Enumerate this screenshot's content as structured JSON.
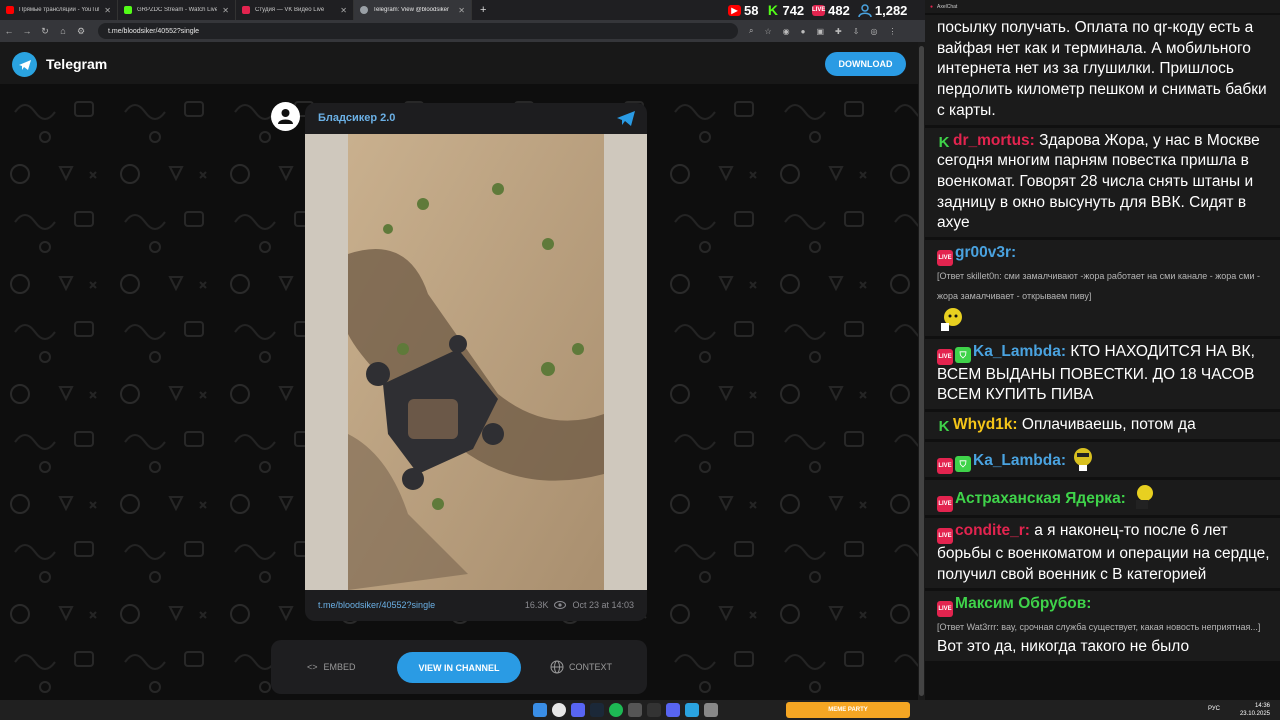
{
  "browser": {
    "tabs": [
      {
        "title": "Прямые трансляции - YouTube",
        "color": "#ff0000"
      },
      {
        "title": "GRPZDC Stream - Watch Live o",
        "color": "#53fc18"
      },
      {
        "title": "Студия — VK Видео Live",
        "color": "#e3244f"
      },
      {
        "title": "Telegram: View @bloodsiker",
        "color": "#9aa0a6"
      }
    ],
    "new_tab": "+",
    "url": "t.me/bloodsiker/40552?single"
  },
  "stream_stats": {
    "youtube": "58",
    "kick": "742",
    "vk": "482",
    "viewers": "1,282"
  },
  "telegram": {
    "brand": "Telegram",
    "download": "DOWNLOAD",
    "channel_name": "Бладсикер 2.0",
    "post_link": "t.me/bloodsiker/40552?single",
    "views": "16.3K",
    "date": "Oct 23 at 14:03",
    "embed": "EMBED",
    "view_in_channel": "VIEW IN CHANNEL",
    "context": "CONTEXT"
  },
  "chat": {
    "app_title": "AxelChat",
    "messages": [
      {
        "text": "посылку получать. Оплата по qr-коду есть а вайфая нет как и терминала. А мобильного интернета нет из за глушилки. Пришлось пердолить километр пешком и снимать бабки с карты."
      },
      {
        "nick": "dr_mortus:",
        "text": "Здарова Жора, у нас в Москве сегодня многим парням повестка пришла в военкомат. Говорят 28 числа снять штаны и задницу в окно высунуть для ВВК. Сидят в ахуе"
      },
      {
        "nick": "gr00v3r:",
        "reply": "[Ответ skillet0n: сми замалчивают -жора работает на сми канале - жора сми - жора замалчивает - открываем пиву]"
      },
      {
        "nick": "Ka_Lambda:",
        "text": "КТО НАХОДИТСЯ НА ВК, ВСЕМ ВЫДАНЫ ПОВЕСТКИ. ДО 18 ЧАСОВ ВСЕМ КУПИТЬ ПИВА"
      },
      {
        "nick": "Whyd1k:",
        "text": "Оплачиваешь, потом да"
      },
      {
        "nick": "Ka_Lambda:"
      },
      {
        "nick": "Астраханская Ядерка:"
      },
      {
        "nick": "condite_r:",
        "text": "а я наконец-то после 6 лет борьбы с военкоматом и операции на сердце, получил свой военник с В категорией"
      },
      {
        "nick": "Максим Обрубов:",
        "reply": "[Ответ Wat3rrr: вау, срочная служба существует, какая новость неприятная...]",
        "text": "Вот это да, никогда такого не было"
      }
    ]
  },
  "taskbar": {
    "lang": "РУС",
    "time": "14:36",
    "date": "23.10.2025",
    "meme_party": "MEME PARTY"
  },
  "colors": {
    "telegram_blue": "#2a9be4",
    "link_blue": "#6bb0e5",
    "nick_red": "#e3244f",
    "nick_blue": "#4aa3e0",
    "nick_green": "#3fd34a",
    "nick_yellow": "#f5c518"
  }
}
